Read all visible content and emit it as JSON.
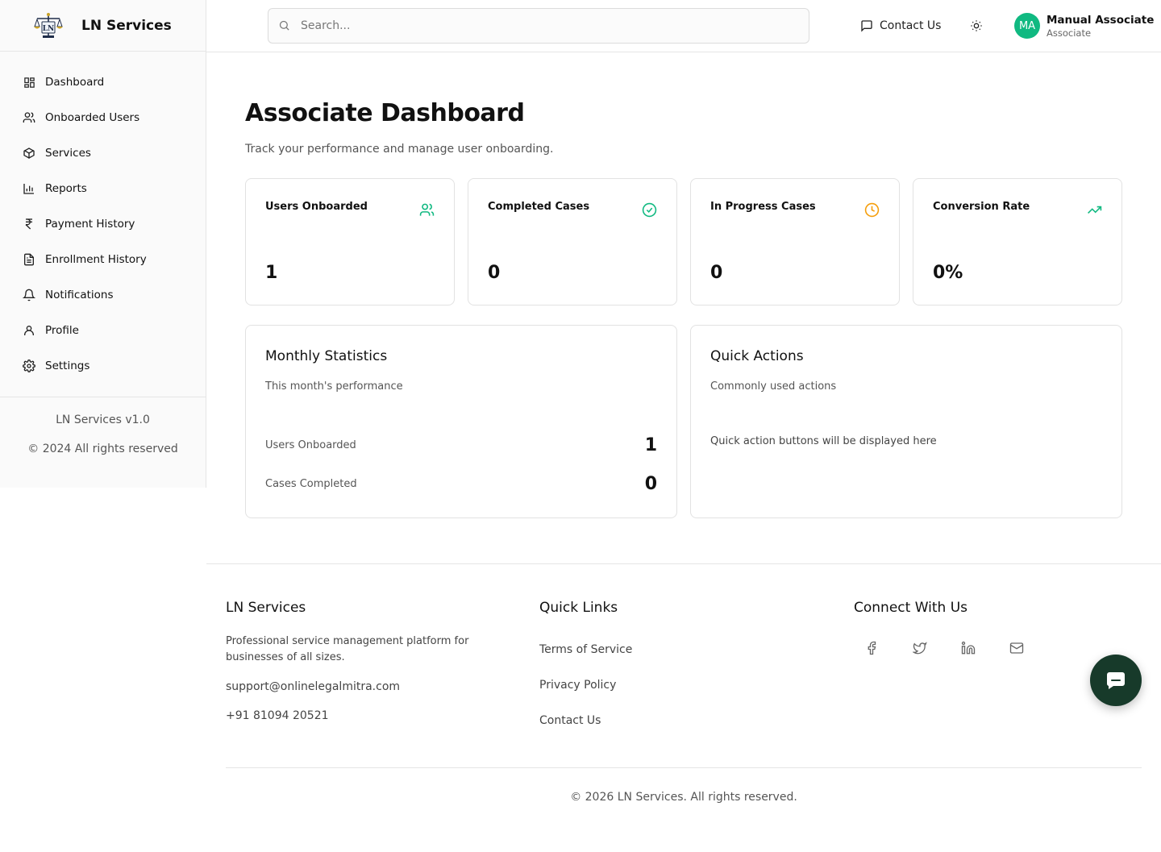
{
  "brand": {
    "name": "LN Services",
    "logo_icon": "scales-of-justice-logo",
    "logo_text": "LN"
  },
  "sidebar": {
    "items": [
      {
        "label": "Dashboard",
        "icon": "dashboard-grid-icon"
      },
      {
        "label": "Onboarded Users",
        "icon": "users-icon"
      },
      {
        "label": "Services",
        "icon": "package-icon"
      },
      {
        "label": "Reports",
        "icon": "bar-chart-icon"
      },
      {
        "label": "Payment History",
        "icon": "rupee-icon"
      },
      {
        "label": "Enrollment History",
        "icon": "file-text-icon"
      },
      {
        "label": "Notifications",
        "icon": "bell-icon"
      },
      {
        "label": "Profile",
        "icon": "user-icon"
      },
      {
        "label": "Settings",
        "icon": "gear-icon"
      }
    ],
    "version": "LN Services v1.0",
    "copyright": "© 2024 All rights reserved"
  },
  "header": {
    "search_placeholder": "Search...",
    "contact_label": "Contact Us",
    "user": {
      "initials": "MA",
      "name": "Manual Associate",
      "role": "Associate"
    }
  },
  "main": {
    "title": "Associate Dashboard",
    "subtitle": "Track your performance and manage user onboarding.",
    "cards": [
      {
        "title": "Users Onboarded",
        "value": "1",
        "icon": "users-icon",
        "color": "#10b981"
      },
      {
        "title": "Completed Cases",
        "value": "0",
        "icon": "check-circle-icon",
        "color": "#10b981"
      },
      {
        "title": "In Progress Cases",
        "value": "0",
        "icon": "clock-icon",
        "color": "#f59e0b"
      },
      {
        "title": "Conversion Rate",
        "value": "0%",
        "icon": "trending-up-icon",
        "color": "#10b981"
      }
    ],
    "monthly": {
      "title": "Monthly Statistics",
      "subtitle": "This month's performance",
      "rows": [
        {
          "label": "Users Onboarded",
          "value": "1"
        },
        {
          "label": "Cases Completed",
          "value": "0"
        }
      ]
    },
    "quick": {
      "title": "Quick Actions",
      "subtitle": "Commonly used actions",
      "placeholder": "Quick action buttons will be displayed here"
    }
  },
  "footer": {
    "about": {
      "title": "LN Services",
      "description": "Professional service management platform for businesses of all sizes.",
      "email": "support@onlinelegalmitra.com",
      "phone": "+91 81094 20521"
    },
    "links": {
      "title": "Quick Links",
      "items": [
        "Terms of Service",
        "Privacy Policy",
        "Contact Us"
      ]
    },
    "connect": {
      "title": "Connect With Us",
      "socials": [
        "facebook-icon",
        "twitter-icon",
        "linkedin-icon",
        "mail-icon"
      ]
    },
    "copyright": "© 2026 LN Services. All rights reserved."
  },
  "colors": {
    "accent": "#10b981",
    "avatar": "#10b981",
    "chat_button": "#173a2a",
    "warning": "#f59e0b"
  }
}
